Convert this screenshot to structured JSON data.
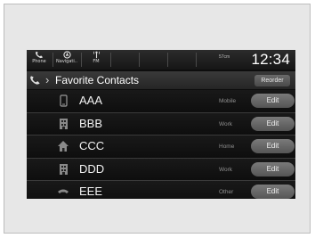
{
  "statusbar": {
    "buttons": [
      {
        "label": "Phone",
        "icon": "phone-icon"
      },
      {
        "label": "Navigati..",
        "icon": "navigation-icon"
      },
      {
        "label": "FM",
        "icon": "radio-icon"
      }
    ],
    "mode": "57cm",
    "clock": "12:34"
  },
  "titlebar": {
    "icon": "phone-icon",
    "title": "Favorite Contacts",
    "reorder_label": "Reorder"
  },
  "contacts": [
    {
      "name": "AAA",
      "type": "Mobile",
      "icon": "mobile-phone-icon",
      "edit_label": "Edit"
    },
    {
      "name": "BBB",
      "type": "Work",
      "icon": "building-icon",
      "edit_label": "Edit"
    },
    {
      "name": "CCC",
      "type": "Home",
      "icon": "house-icon",
      "edit_label": "Edit"
    },
    {
      "name": "DDD",
      "type": "Work",
      "icon": "building-icon",
      "edit_label": "Edit"
    },
    {
      "name": "EEE",
      "type": "Other",
      "icon": "other-phone-icon",
      "edit_label": "Edit"
    }
  ],
  "colors": {
    "screen_background": "#0d0d0d",
    "button_gray": "#666666",
    "text_white": "#ffffff"
  }
}
